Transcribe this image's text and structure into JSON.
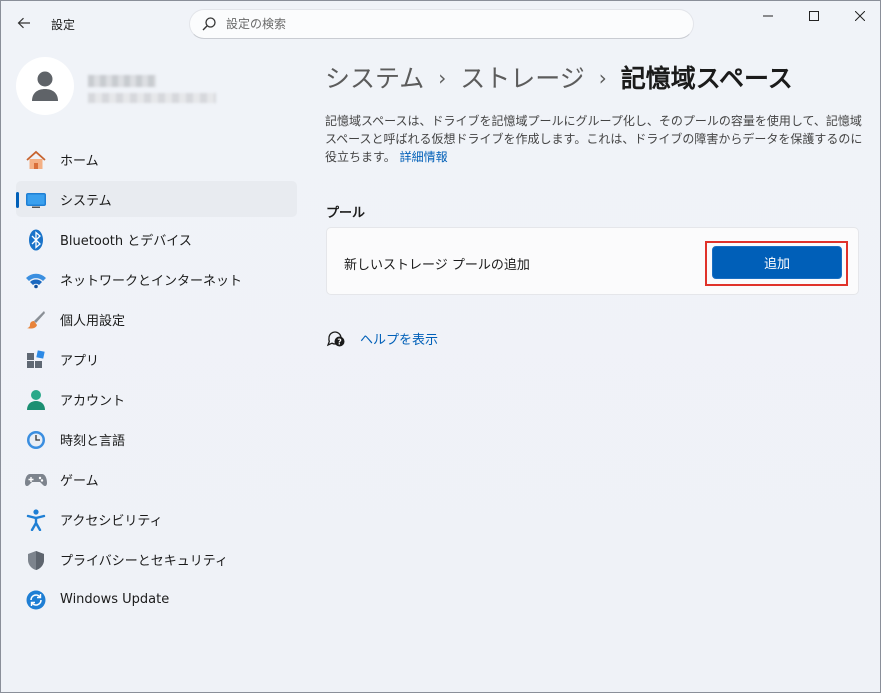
{
  "window": {
    "title": "設定"
  },
  "search": {
    "placeholder": "設定の検索"
  },
  "sidebar": {
    "items": [
      {
        "label": "ホーム",
        "icon": "home-icon",
        "active": false
      },
      {
        "label": "システム",
        "icon": "system-icon",
        "active": true
      },
      {
        "label": "Bluetooth とデバイス",
        "icon": "bluetooth-icon",
        "active": false
      },
      {
        "label": "ネットワークとインターネット",
        "icon": "wifi-icon",
        "active": false
      },
      {
        "label": "個人用設定",
        "icon": "brush-icon",
        "active": false
      },
      {
        "label": "アプリ",
        "icon": "apps-icon",
        "active": false
      },
      {
        "label": "アカウント",
        "icon": "account-icon",
        "active": false
      },
      {
        "label": "時刻と言語",
        "icon": "time-language-icon",
        "active": false
      },
      {
        "label": "ゲーム",
        "icon": "gamepad-icon",
        "active": false
      },
      {
        "label": "アクセシビリティ",
        "icon": "accessibility-icon",
        "active": false
      },
      {
        "label": "プライバシーとセキュリティ",
        "icon": "shield-icon",
        "active": false
      },
      {
        "label": "Windows Update",
        "icon": "update-icon",
        "active": false
      }
    ]
  },
  "breadcrumb": {
    "items": [
      "システム",
      "ストレージ",
      "記憶域スペース"
    ],
    "separator": "›"
  },
  "main": {
    "description": "記憶域スペースは、ドライブを記憶域プールにグループ化し、そのプールの容量を使用して、記憶域スペースと呼ばれる仮想ドライブを作成します。これは、ドライブの障害からデータを保護するのに役立ちます。",
    "learn_more": "詳細情報",
    "section_title": "プール",
    "card_label": "新しいストレージ プールの追加",
    "add_button": "追加",
    "help_link": "ヘルプを表示"
  },
  "colors": {
    "accent": "#005fb8",
    "highlight_border": "#e0322a",
    "background": "#eef1f6"
  }
}
